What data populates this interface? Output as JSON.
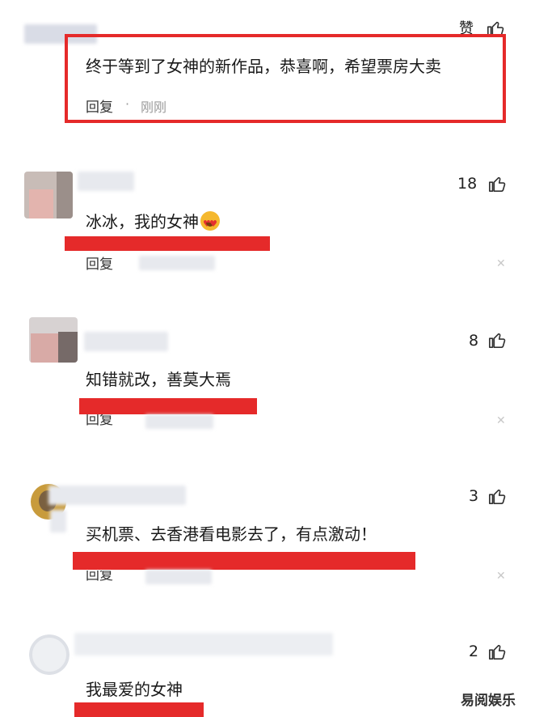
{
  "comments": [
    {
      "text": "终于等到了女神的新作品，恭喜啊，希望票房大卖",
      "reply": "回复",
      "dot": "·",
      "time": "刚刚",
      "like": "赞"
    },
    {
      "text": "冰冰，我的女神",
      "emoji": "heart-eyes",
      "reply": "回复",
      "likes": "18"
    },
    {
      "text": "知错就改，善莫大焉",
      "reply": "回复",
      "likes": "8"
    },
    {
      "text": "买机票、去香港看电影去了，有点激动！",
      "reply": "回复",
      "likes": "3"
    },
    {
      "text": "我最爱的女神",
      "likes": "2"
    }
  ],
  "watermark": "易阅娱乐",
  "colors": {
    "highlight": "#e52a2a",
    "blur": "#e7e9ee"
  },
  "icons": {
    "like": "thumbs-up-icon",
    "close": "close-icon"
  }
}
